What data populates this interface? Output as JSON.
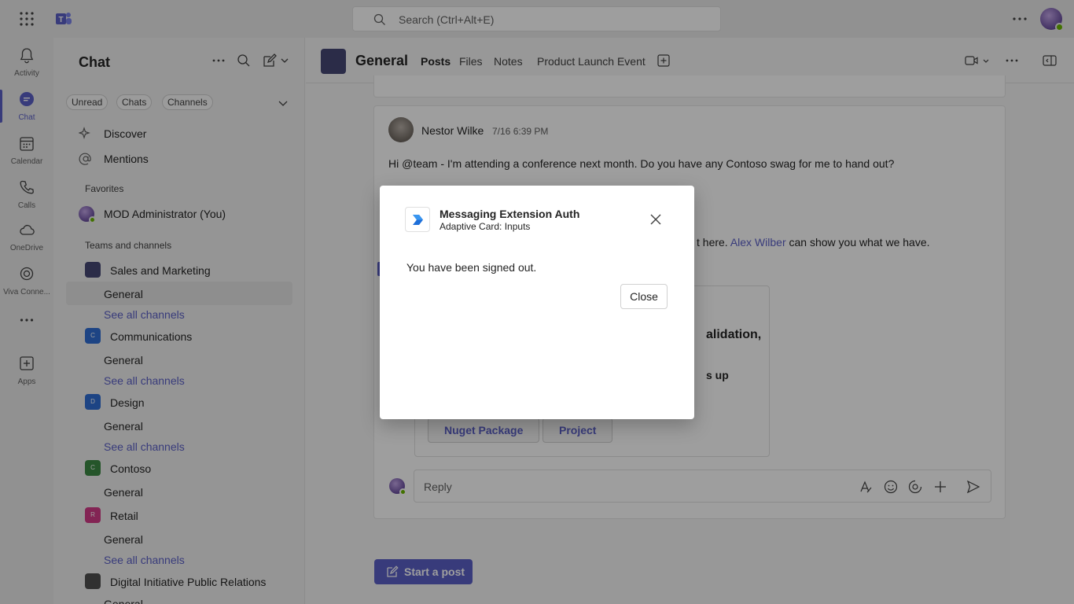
{
  "topbar": {
    "search_placeholder": "Search (Ctrl+Alt+E)"
  },
  "rail": {
    "items": [
      {
        "label": "Activity",
        "icon": "bell-icon"
      },
      {
        "label": "Chat",
        "icon": "chat-icon"
      },
      {
        "label": "Calendar",
        "icon": "calendar-icon"
      },
      {
        "label": "Calls",
        "icon": "phone-icon"
      },
      {
        "label": "OneDrive",
        "icon": "cloud-icon"
      },
      {
        "label": "Viva Conne...",
        "icon": "viva-connections-icon"
      },
      {
        "label": "Apps",
        "icon": "apps-icon"
      }
    ]
  },
  "chat_panel": {
    "title": "Chat",
    "filters": [
      "Unread",
      "Chats",
      "Channels"
    ],
    "discover": "Discover",
    "mentions": "Mentions",
    "favorites_heading": "Favorites",
    "favorite_user": "MOD Administrator (You)",
    "teams_heading": "Teams and channels",
    "teams": [
      {
        "name": "Sales and Marketing",
        "icon_letter": "",
        "color": "#464775"
      },
      {
        "name": "Communications",
        "icon_letter": "C",
        "color": "#2f6fd6"
      },
      {
        "name": "Design",
        "icon_letter": "D",
        "color": "#2f6fd6"
      },
      {
        "name": "Contoso",
        "icon_letter": "C",
        "color": "#3d8a45"
      },
      {
        "name": "Retail",
        "icon_letter": "R",
        "color": "#d33a88"
      },
      {
        "name": "Digital Initiative Public Relations",
        "icon_letter": "",
        "color": "#505050"
      }
    ],
    "channel_general": "General",
    "see_all": "See all channels"
  },
  "channel": {
    "title": "General",
    "tabs": [
      "Posts",
      "Files",
      "Notes",
      "Product Launch Event"
    ]
  },
  "post": {
    "author": "Nestor Wilke",
    "timestamp": "7/16 6:39 PM",
    "message": "Hi @team - I'm attending a conference next month. Do you have any Contoso swag for me to hand out?",
    "reply_fragment_before": "t here. ",
    "reply_mention": "Alex Wilber",
    "reply_fragment_after": " can show you what we have.",
    "card_fragment_1": "alidation,",
    "card_fragment_2": "s up",
    "card_buttons": [
      "Nuget Package",
      "Project"
    ],
    "reply_placeholder": "Reply"
  },
  "start_post_label": "Start a post",
  "dialog": {
    "title": "Messaging Extension Auth",
    "subtitle": "Adaptive Card: Inputs",
    "message": "You have been signed out.",
    "close_label": "Close"
  },
  "colors": {
    "accent": "#5b5fc7",
    "presence_available": "#6bb700"
  }
}
